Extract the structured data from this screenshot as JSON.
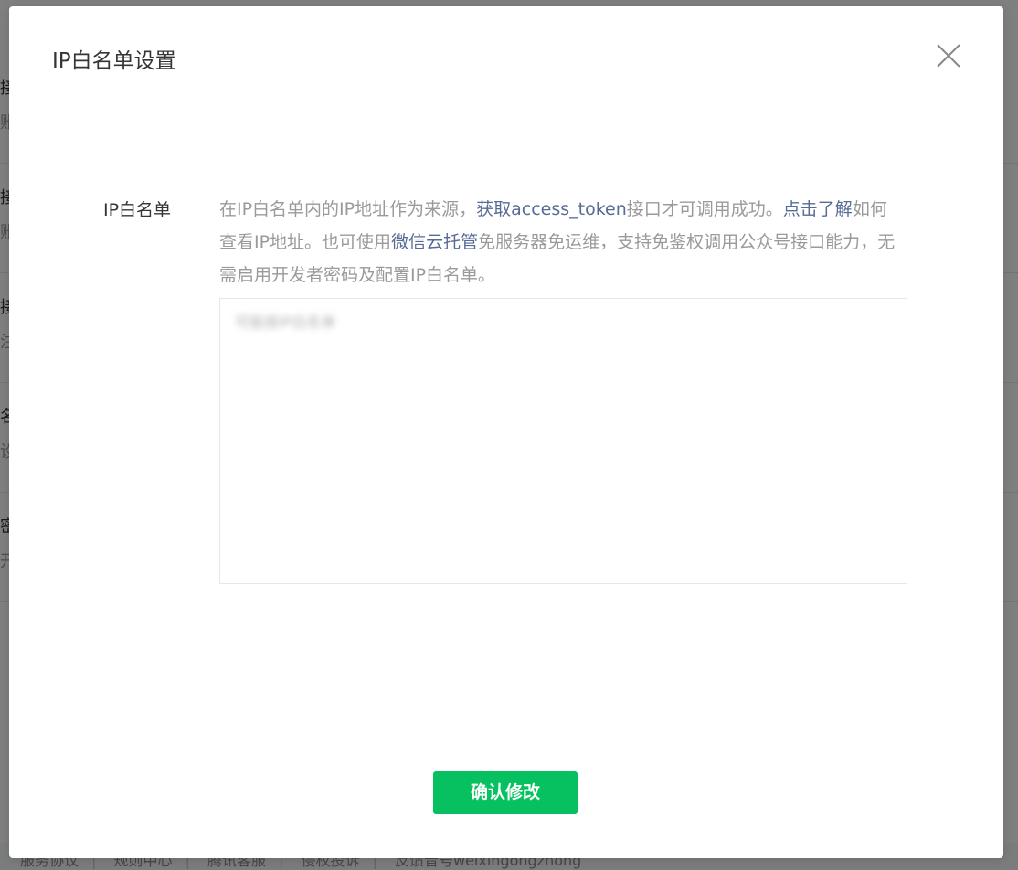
{
  "dialog": {
    "title": "IP白名单设置",
    "field_label": "IP白名单",
    "tip": {
      "part1": "在IP白名单内的IP地址作为来源，",
      "link1": "获取access_token",
      "part2": "接口才可调用成功。",
      "link2": "点击了解",
      "part3": "如何查看IP地址。也可使用",
      "link3": "微信云托管",
      "part4": "免服务器免运维，支持免鉴权调用公众号接口能力，无需启用开发者密码及配置IP白名单。"
    },
    "textarea_placeholder": "可能接IP白名单",
    "confirm_label": "确认修改"
  },
  "background": {
    "rows": [
      {
        "t1": "接",
        "t2": "账"
      },
      {
        "t1": "接",
        "t2": "账"
      },
      {
        "t1": "接",
        "t2": "注"
      },
      {
        "t1": "名",
        "t2": "设"
      },
      {
        "t1": "密",
        "t2": "开"
      }
    ],
    "footer_links": [
      "服务协议",
      "规则中心",
      "腾讯客服",
      "侵权投诉",
      "反馈音号weixingongzhong"
    ]
  },
  "colors": {
    "primary": "#07c160",
    "link": "#576b95",
    "text": "#353535",
    "muted": "#9a9a9a"
  },
  "icons": {
    "close": "close-icon"
  }
}
